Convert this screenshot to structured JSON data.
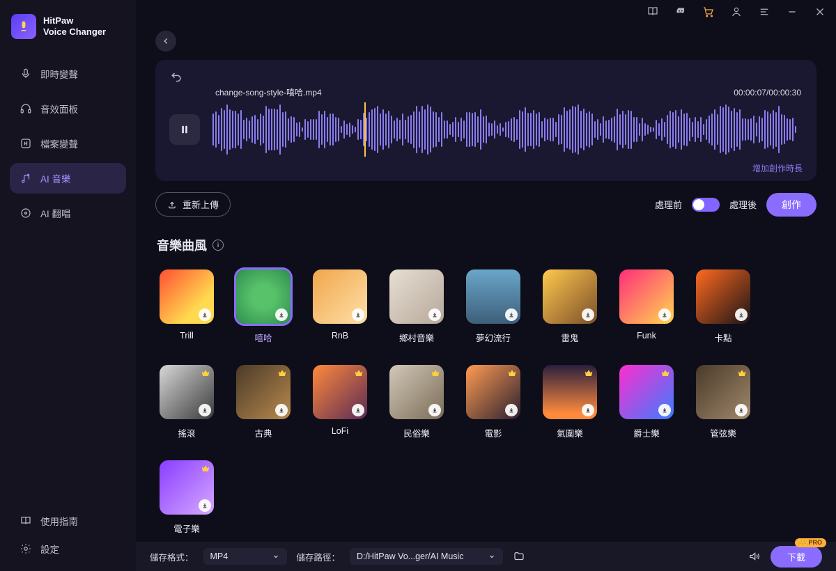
{
  "brand": {
    "title": "HitPaw\nVoice Changer"
  },
  "sidebar": {
    "items": [
      {
        "label": "即時變聲"
      },
      {
        "label": "音效面板"
      },
      {
        "label": "檔案變聲"
      },
      {
        "label": "AI 音樂"
      },
      {
        "label": "AI 翻唱"
      }
    ],
    "bottom": [
      {
        "label": "使用指南"
      },
      {
        "label": "設定"
      }
    ]
  },
  "player": {
    "track_name": "change-song-style-嘻哈.mp4",
    "time": "00:00:07/00:00:30",
    "extend_label": "增加創作時長"
  },
  "toolbar": {
    "reupload": "重新上傳",
    "before": "處理前",
    "after": "處理後",
    "create": "創作"
  },
  "section": {
    "title": "音樂曲風"
  },
  "styles": [
    {
      "label": "Trill",
      "bg": 0,
      "crown": false
    },
    {
      "label": "嘻哈",
      "bg": 1,
      "crown": false,
      "selected": true
    },
    {
      "label": "RnB",
      "bg": 2,
      "crown": false
    },
    {
      "label": "鄉村音樂",
      "bg": 3,
      "crown": false
    },
    {
      "label": "夢幻流行",
      "bg": 4,
      "crown": false
    },
    {
      "label": "雷鬼",
      "bg": 5,
      "crown": false
    },
    {
      "label": "Funk",
      "bg": 6,
      "crown": false
    },
    {
      "label": "卡點",
      "bg": 7,
      "crown": false
    },
    {
      "label": "搖滾",
      "bg": 8,
      "crown": true
    },
    {
      "label": "古典",
      "bg": 9,
      "crown": true
    },
    {
      "label": "LoFi",
      "bg": 10,
      "crown": true
    },
    {
      "label": "民俗樂",
      "bg": 11,
      "crown": true
    },
    {
      "label": "電影",
      "bg": 12,
      "crown": true
    },
    {
      "label": "氣圍樂",
      "bg": 13,
      "crown": true
    },
    {
      "label": "爵士樂",
      "bg": 14,
      "crown": true
    },
    {
      "label": "管弦樂",
      "bg": 15,
      "crown": true
    },
    {
      "label": "電子樂",
      "bg": 16,
      "crown": true
    }
  ],
  "footer": {
    "format_label": "儲存格式：",
    "format_value": "MP4",
    "path_label": "儲存路徑：",
    "path_value": "D:/HitPaw Vo...ger/AI Music",
    "download": "下載",
    "pro": "PRO"
  }
}
